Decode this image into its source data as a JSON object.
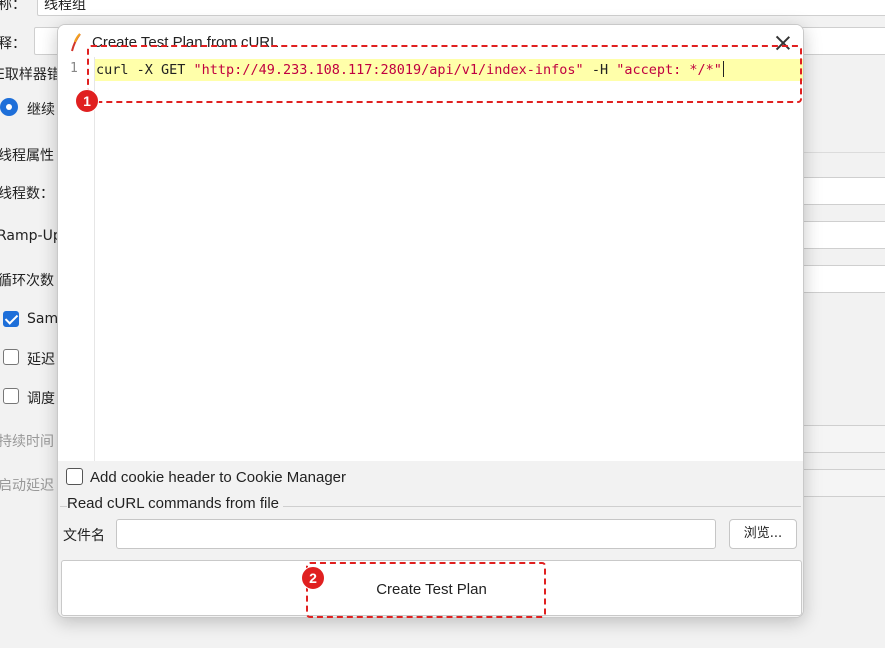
{
  "background": {
    "name_label": "称：",
    "name_value": "线程组",
    "comment_label": "释：",
    "sampler_error_label": "E取样器错",
    "continue_label": "继续",
    "thread_props_label": "线程属性",
    "thread_count_label": "线程数：",
    "rampup_label": "Ramp-Up",
    "loop_label": "循环次数",
    "same_user_label": "Sam",
    "delay_label": "延迟",
    "scheduler_label": "调度",
    "duration_label": "持续时间",
    "startup_delay_label": "启动延迟"
  },
  "dialog": {
    "title": "Create Test Plan from cURL",
    "line_number": "1",
    "code": {
      "cmd": "curl -X GET ",
      "url": "\"http://49.233.108.117:28019/api/v1/index-infos\"",
      "flag": " -H ",
      "header": "\"accept: */*\""
    },
    "cookie_checkbox_label": "Add cookie header to Cookie Manager",
    "cookie_checked": false,
    "file_group_title": "Read cURL commands from file",
    "file_label": "文件名",
    "file_value": "",
    "browse_label": "浏览...",
    "create_button_label": "Create Test Plan"
  },
  "annotations": [
    {
      "number": "1",
      "target": "curl-command-line"
    },
    {
      "number": "2",
      "target": "create-test-plan-button"
    }
  ],
  "colors": {
    "annotation": "#e02020",
    "code_highlight": "#ffffaa",
    "string_token": "#c00040",
    "accent": "#1e6fd9"
  }
}
